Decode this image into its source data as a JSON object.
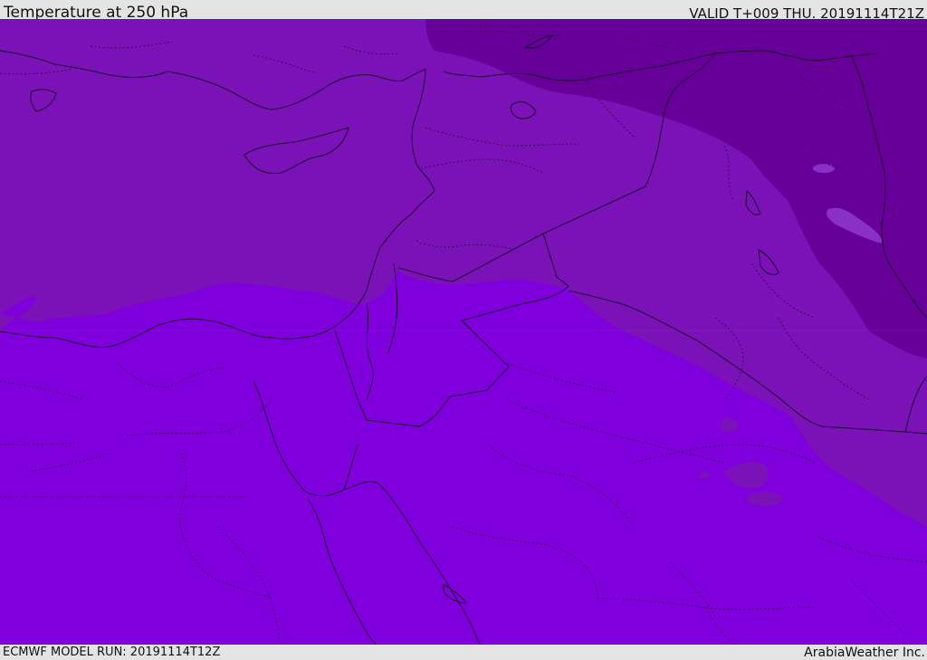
{
  "header": {
    "title": "Temperature at 250 hPa",
    "valid": "VALID T+009 THU. 20191114T21Z"
  },
  "footer": {
    "model_run": "ECMWF MODEL RUN: 20191114T12Z",
    "credit": "ArabiaWeather Inc."
  },
  "colors": {
    "warm_band": "#7f00dc",
    "mid_band": "#7a12b8",
    "cold_band": "#670099",
    "boundary_line": "#1a0a2a"
  }
}
